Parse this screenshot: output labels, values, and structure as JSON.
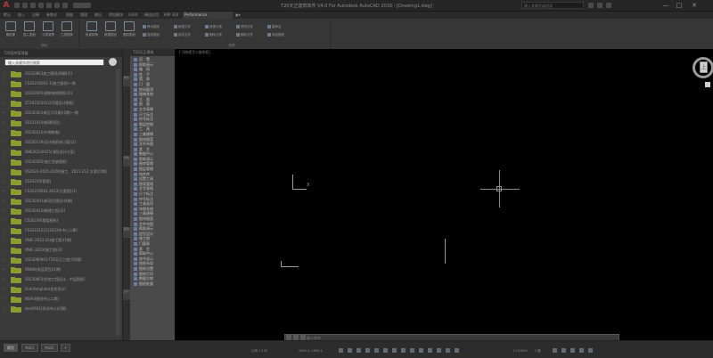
{
  "window": {
    "title": "T20天正建筑软件 V4.0 For Autodesk AutoCAD 2016 - [Drawing1.dwg]",
    "search_placeholder": "键入关键字或短语",
    "controls": [
      "—",
      "□",
      "✕"
    ]
  },
  "ribbon": {
    "tabs": [
      {
        "label": "默认",
        "active": false
      },
      {
        "label": "插入",
        "active": false
      },
      {
        "label": "注释",
        "active": false
      },
      {
        "label": "参数化",
        "active": false
      },
      {
        "label": "视图",
        "active": false
      },
      {
        "label": "管理",
        "active": false
      },
      {
        "label": "输出",
        "active": false
      },
      {
        "label": "附加模块",
        "active": false
      },
      {
        "label": "A360",
        "active": false
      },
      {
        "label": "精选应用",
        "active": false
      },
      {
        "label": "BIM 360",
        "active": false
      },
      {
        "label": "Performance",
        "active": true
      },
      {
        "label": "▣▾",
        "active": false
      }
    ],
    "large_buttons": [
      "图纸集",
      "插入图纸",
      "分类管理",
      "工程图库",
      "批量转换",
      "新建图纸",
      "删除图纸"
    ],
    "small_buttons_a": [
      "移动图纸",
      "新建文件",
      "新建分类",
      "修改文件",
      "重命名"
    ],
    "small_buttons_b": [
      "复制图纸",
      "另存文件",
      "删除分类",
      "删除文件",
      "添加图纸"
    ],
    "group_labels": [
      "图纸",
      "管理"
    ]
  },
  "left_panel": {
    "title": "T20图库管理器",
    "search_placeholder": "输入关键字进行搜索",
    "folders": [
      "20220801施工图纸(四期)(1)",
      "CS20230001-1(施工图纸)一期",
      "20220505(建筑装修图纸)(2)",
      "ZT20230101(2号楼设计图纸)",
      "20230301南区(1号楼)(1期)一期",
      "20221010(新建项目)",
      "20230210(中期审查)",
      "20230119(设计图纸修订版)(1)",
      "DNE20230425(消防设计方案)",
      "20230305(施工验收图纸)",
      "XS2023-2025-2026(施工、2021-212 方案)(1期)",
      "ZS20230(套图)",
      "CS20230501-2023(方案图)(1)",
      "20230301(新项目建设)(4期)",
      "20230410(新建工程)(2)",
      "CS20230(楼层图纸)",
      "CS20231212(2023年中心二期)",
      "XNIC-2023.01(施工图)(1期)",
      "XNIC-2023(施工图)(2)",
      "2023080901-T20天正工程(3号楼)",
      "XNNN(多层项目)(1期)",
      "20230801(住宅工程设计、中层图纸)",
      "ForkTemplate(住宅设计)",
      "NSAV(图纸中心二期)",
      "test0601(测试中心)(2期)"
    ]
  },
  "menu_column": {
    "title": "T20天正建筑",
    "items": [
      "设　置",
      "帮助演示",
      "轴　网",
      "柱　子",
      "墙　体",
      "门　窗",
      "房间屋顶",
      "楼梯其他",
      "立　面",
      "剖　面",
      "文字表格",
      "尺寸标注",
      "符号标注",
      "图层控制",
      "工　具",
      "三维建模",
      "图块图案",
      "文件布图",
      "其　它",
      "数据中心",
      "帮助演示",
      "图库管理",
      "图层管理",
      "构件库",
      "设置工具",
      "图案管理",
      "文字表格",
      "尺寸标注",
      "符号标注",
      "工具选项",
      "布图系统",
      "三维建模",
      "图块图案",
      "文件布图",
      "帮助演示",
      "造型设计",
      "施工图",
      "门窗表",
      "其　它",
      "帮助中心",
      "命令显示",
      "图纸布局",
      "图纸设置",
      "图纸打印",
      "数据交换",
      "图纸批量"
    ]
  },
  "vertical_tabs_left": [
    "属性",
    "特性",
    "图层",
    "设计"
  ],
  "vertical_tabs_right": [
    "工具",
    "图纸",
    "样式"
  ],
  "canvas": {
    "viewport_label": "[-][俯视][二维线框]",
    "viewcube_face": "上",
    "viewcube_labels": [
      "北",
      "西",
      "东",
      "南"
    ],
    "ucs_axis_label": "X"
  },
  "command_line": {
    "prompt": "键入命令"
  },
  "status_bar": {
    "layout_tabs": [
      {
        "label": "模型",
        "active": true
      },
      {
        "label": "布局1",
        "active": false
      },
      {
        "label": "布局2",
        "active": false
      }
    ],
    "add_tab": "+",
    "scale": "比例 1:100",
    "coords": "3600.0,-1600.0",
    "items": [
      "模型",
      "1:1/100%",
      "小数"
    ]
  }
}
